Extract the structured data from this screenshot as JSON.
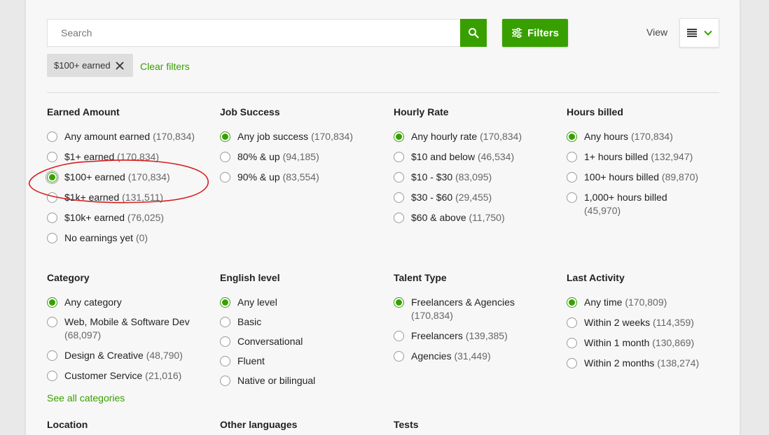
{
  "search": {
    "placeholder": "Search"
  },
  "toolbar": {
    "filters_label": "Filters",
    "view_label": "View"
  },
  "active_filter": {
    "label": "$100+ earned"
  },
  "clear_filters": "Clear filters",
  "see_all_categories": "See all categories",
  "accent_color": "#37a000",
  "filter_groups": [
    {
      "title": "Earned Amount",
      "options": [
        {
          "label": "Any amount earned",
          "count": "(170,834)",
          "selected": false
        },
        {
          "label": "$1+ earned",
          "count": "(170,834)",
          "selected": false
        },
        {
          "label": "$100+ earned",
          "count": "(170,834)",
          "selected": true
        },
        {
          "label": "$1k+ earned",
          "count": "(131,511)",
          "selected": false
        },
        {
          "label": "$10k+ earned",
          "count": "(76,025)",
          "selected": false
        },
        {
          "label": "No earnings yet",
          "count": "(0)",
          "selected": false
        }
      ]
    },
    {
      "title": "Job Success",
      "options": [
        {
          "label": "Any job success",
          "count": "(170,834)",
          "selected": true
        },
        {
          "label": "80% & up",
          "count": "(94,185)",
          "selected": false
        },
        {
          "label": "90% & up",
          "count": "(83,554)",
          "selected": false
        }
      ]
    },
    {
      "title": "Hourly Rate",
      "options": [
        {
          "label": "Any hourly rate",
          "count": "(170,834)",
          "selected": true
        },
        {
          "label": "$10 and below",
          "count": "(46,534)",
          "selected": false
        },
        {
          "label": "$10 - $30",
          "count": "(83,095)",
          "selected": false
        },
        {
          "label": "$30 - $60",
          "count": "(29,455)",
          "selected": false
        },
        {
          "label": "$60 & above",
          "count": "(11,750)",
          "selected": false
        }
      ]
    },
    {
      "title": "Hours billed",
      "options": [
        {
          "label": "Any hours",
          "count": "(170,834)",
          "selected": true
        },
        {
          "label": "1+ hours billed",
          "count": "(132,947)",
          "selected": false
        },
        {
          "label": "100+ hours billed",
          "count": "(89,870)",
          "selected": false
        },
        {
          "label": "1,000+ hours billed",
          "count": "(45,970)",
          "selected": false
        }
      ]
    },
    {
      "title": "Category",
      "options": [
        {
          "label": "Any category",
          "count": "",
          "selected": true
        },
        {
          "label": "Web, Mobile & Software Dev",
          "count": "(68,097)",
          "selected": false
        },
        {
          "label": "Design & Creative",
          "count": "(48,790)",
          "selected": false
        },
        {
          "label": "Customer Service",
          "count": "(21,016)",
          "selected": false
        }
      ]
    },
    {
      "title": "English level",
      "options": [
        {
          "label": "Any level",
          "count": "",
          "selected": true
        },
        {
          "label": "Basic",
          "count": "",
          "selected": false
        },
        {
          "label": "Conversational",
          "count": "",
          "selected": false
        },
        {
          "label": "Fluent",
          "count": "",
          "selected": false
        },
        {
          "label": "Native or bilingual",
          "count": "",
          "selected": false
        }
      ]
    },
    {
      "title": "Talent Type",
      "options": [
        {
          "label": "Freelancers & Agencies",
          "count": "(170,834)",
          "selected": true
        },
        {
          "label": "Freelancers",
          "count": "(139,385)",
          "selected": false
        },
        {
          "label": "Agencies",
          "count": "(31,449)",
          "selected": false
        }
      ]
    },
    {
      "title": "Last Activity",
      "options": [
        {
          "label": "Any time",
          "count": "(170,809)",
          "selected": true
        },
        {
          "label": "Within 2 weeks",
          "count": "(114,359)",
          "selected": false
        },
        {
          "label": "Within 1 month",
          "count": "(130,869)",
          "selected": false
        },
        {
          "label": "Within 2 months",
          "count": "(138,274)",
          "selected": false
        }
      ]
    }
  ],
  "more_sections": [
    "Location",
    "Other languages",
    "Tests"
  ]
}
